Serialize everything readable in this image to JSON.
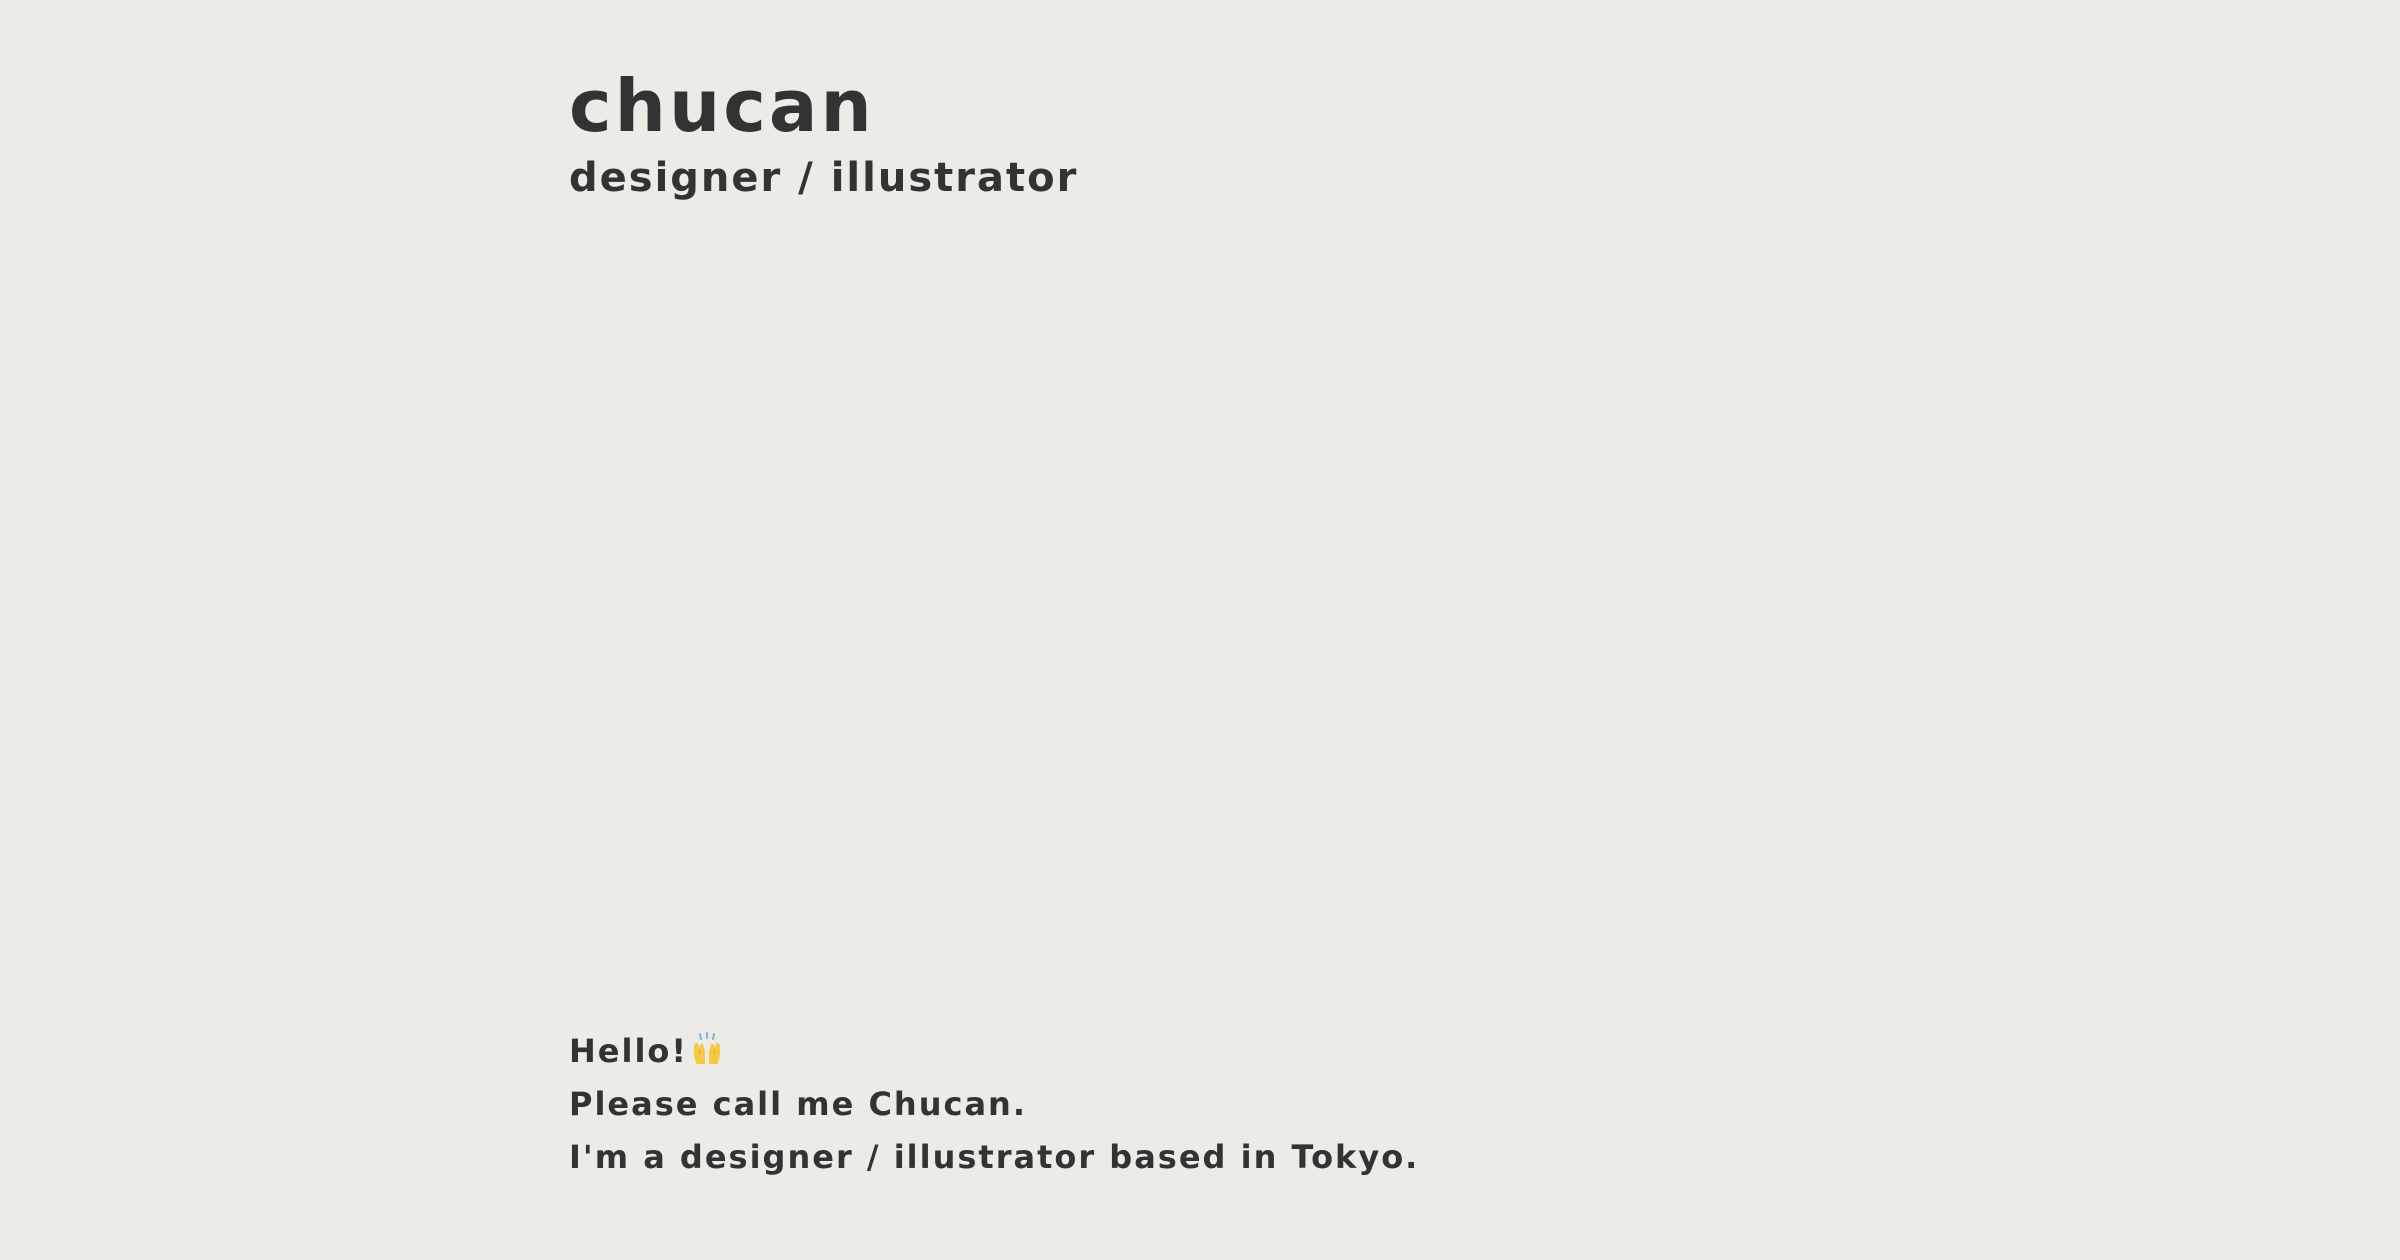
{
  "header": {
    "title": "chucan",
    "subtitle": "designer / illustrator"
  },
  "intro": {
    "greeting": "Hello!",
    "greeting_emoji": "raising-hands-icon",
    "line2": "Please call me Chucan.",
    "line3": "I'm a designer / illustrator based in Tokyo."
  },
  "colors": {
    "background": "#edebe6",
    "text": "#333333",
    "emoji_yellow": "#f6c945",
    "emoji_blue": "#7fb3e6"
  }
}
